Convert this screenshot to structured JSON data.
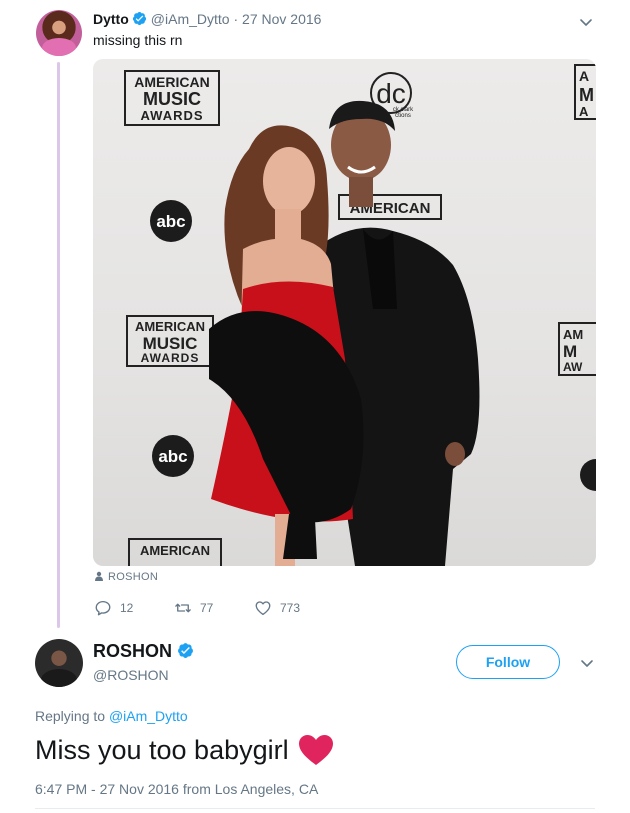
{
  "parent_tweet": {
    "author_name": "Dytto",
    "handle": "@iAm_Dytto",
    "separator": "·",
    "date": "27 Nov 2016",
    "text": "missing this rn",
    "photo_credit": "ROSHON",
    "photo_signage": {
      "ama_line1": "AMERICAN",
      "ama_line2": "MUSIC",
      "ama_line3": "AWARDS",
      "abc": "abc",
      "dc": "dc",
      "dc_small1": "ck clark",
      "dc_small2": "ctions"
    },
    "replies": "12",
    "retweets": "77",
    "likes": "773"
  },
  "main_tweet": {
    "author_name": "ROSHON",
    "handle": "@ROSHON",
    "follow_label": "Follow",
    "replying_prefix": "Replying to",
    "replying_handle": "@iAm_Dytto",
    "text": "Miss you too babygirl",
    "time": "6:47 PM - 27 Nov 2016",
    "from_label": "from",
    "location": "Los Angeles, CA"
  },
  "colors": {
    "accent": "#1da1f2",
    "heart": "#e0245e",
    "muted": "#657786",
    "dress": "#c8101a"
  },
  "icons": [
    "verified-badge-icon",
    "chevron-down-icon",
    "person-icon",
    "reply-icon",
    "retweet-icon",
    "like-icon",
    "heart-emoji-icon"
  ]
}
